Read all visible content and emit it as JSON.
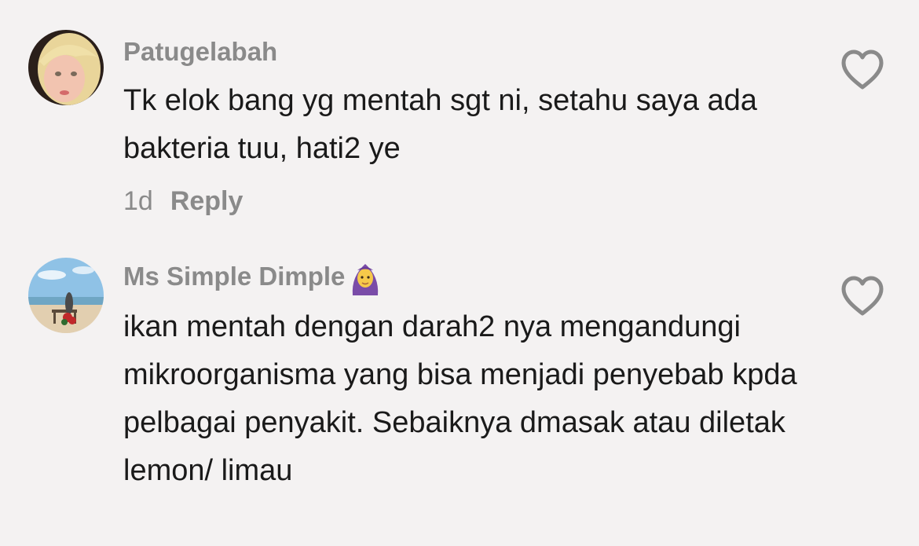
{
  "comments": [
    {
      "username": "Patugelabah",
      "text": "Tk elok bang yg mentah sgt ni, setahu saya ada bakteria tuu, hati2 ye",
      "time": "1d",
      "reply_label": "Reply",
      "like_icon": "heart-outline-icon"
    },
    {
      "username": "Ms Simple Dimple",
      "username_emoji": "woman-with-headscarf-emoji",
      "text": "ikan mentah dengan darah2 nya mengandungi mikroorganisma yang bisa menjadi penyebab kpda pelbagai penyakit. Sebaiknya dmasak atau diletak lemon/ limau",
      "like_icon": "heart-outline-icon"
    }
  ],
  "colors": {
    "background": "#f4f2f2",
    "username": "#8a8a8a",
    "text": "#1a1a1a",
    "icon": "#8a8a8a"
  }
}
